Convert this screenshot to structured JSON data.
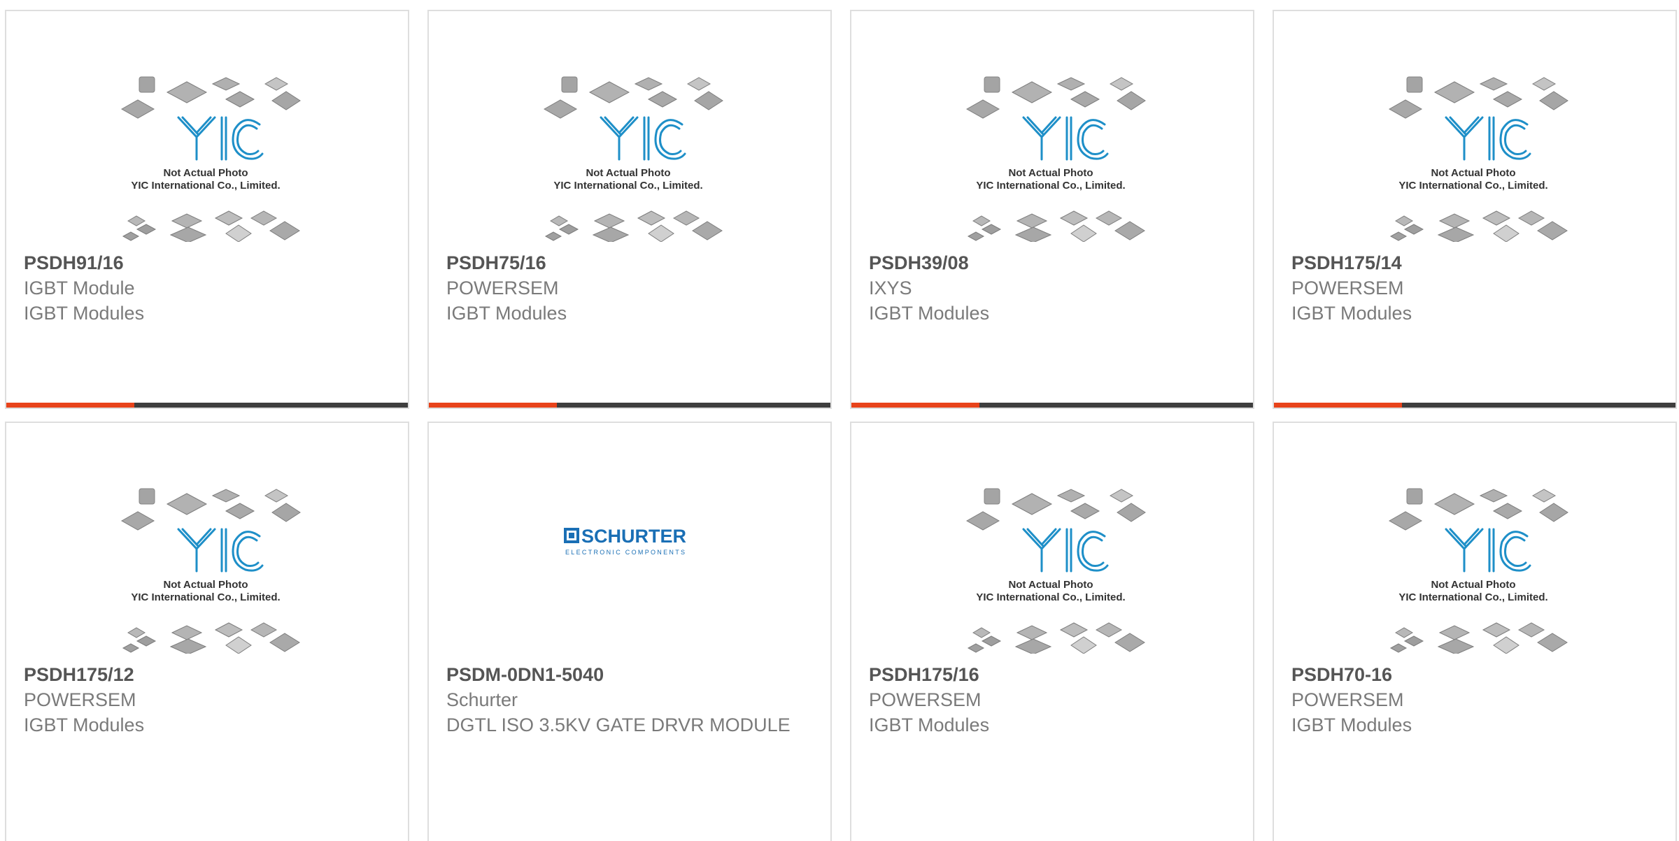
{
  "placeholder": {
    "logo_text": "YIC",
    "caption_line1": "Not Actual Photo",
    "caption_line2": "YIC International Co., Limited."
  },
  "schurter_logo": {
    "name": "SCHURTER",
    "tagline": "ELECTRONIC COMPONENTS"
  },
  "products": [
    {
      "part_number": "PSDH91/16",
      "manufacturer": "IGBT Module",
      "category": "IGBT Modules",
      "image": "yic-placeholder"
    },
    {
      "part_number": "PSDH75/16",
      "manufacturer": "POWERSEM",
      "category": "IGBT Modules",
      "image": "yic-placeholder"
    },
    {
      "part_number": "PSDH39/08",
      "manufacturer": "IXYS",
      "category": "IGBT Modules",
      "image": "yic-placeholder"
    },
    {
      "part_number": "PSDH175/14",
      "manufacturer": "POWERSEM",
      "category": "IGBT Modules",
      "image": "yic-placeholder"
    },
    {
      "part_number": "PSDH175/12",
      "manufacturer": "POWERSEM",
      "category": "IGBT Modules",
      "image": "yic-placeholder"
    },
    {
      "part_number": "PSDM-0DN1-5040",
      "manufacturer": "Schurter",
      "category": "DGTL ISO 3.5KV GATE DRVR MODULE",
      "image": "schurter-logo"
    },
    {
      "part_number": "PSDH175/16",
      "manufacturer": "POWERSEM",
      "category": "IGBT Modules",
      "image": "yic-placeholder"
    },
    {
      "part_number": "PSDH70-16",
      "manufacturer": "POWERSEM",
      "category": "IGBT Modules",
      "image": "yic-placeholder"
    }
  ],
  "colors": {
    "accent": "#e8431b",
    "bar_dark": "#3e3e3e",
    "yic_blue": "#1e8fc8",
    "schurter_blue": "#1a6fb5",
    "chip_gray": "#9a9a9a"
  }
}
